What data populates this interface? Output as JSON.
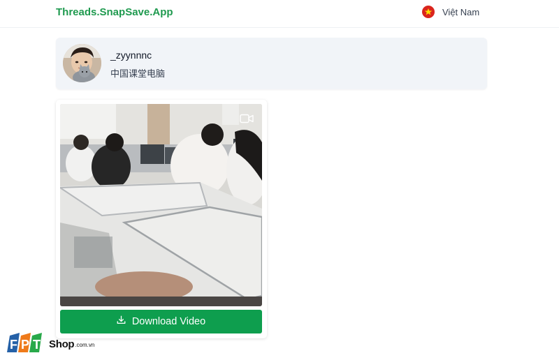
{
  "header": {
    "brand": "Threads.SnapSave.App",
    "language": {
      "label": "Việt Nam",
      "flag": "vietnam-flag"
    }
  },
  "profile": {
    "username": "_zyynnnc",
    "caption": "中国课堂电脑"
  },
  "media": {
    "type_icon": "video-camera-icon",
    "download_label": "Download Video",
    "download_icon": "download-icon"
  },
  "watermark": {
    "brand": "FPT",
    "shop": "Shop",
    "domain": ".com.vn"
  },
  "colors": {
    "brand_green": "#1f9a4f",
    "button_green": "#0e9e4e",
    "profile_bg": "#f1f4f8",
    "flag_red": "#da251d"
  }
}
